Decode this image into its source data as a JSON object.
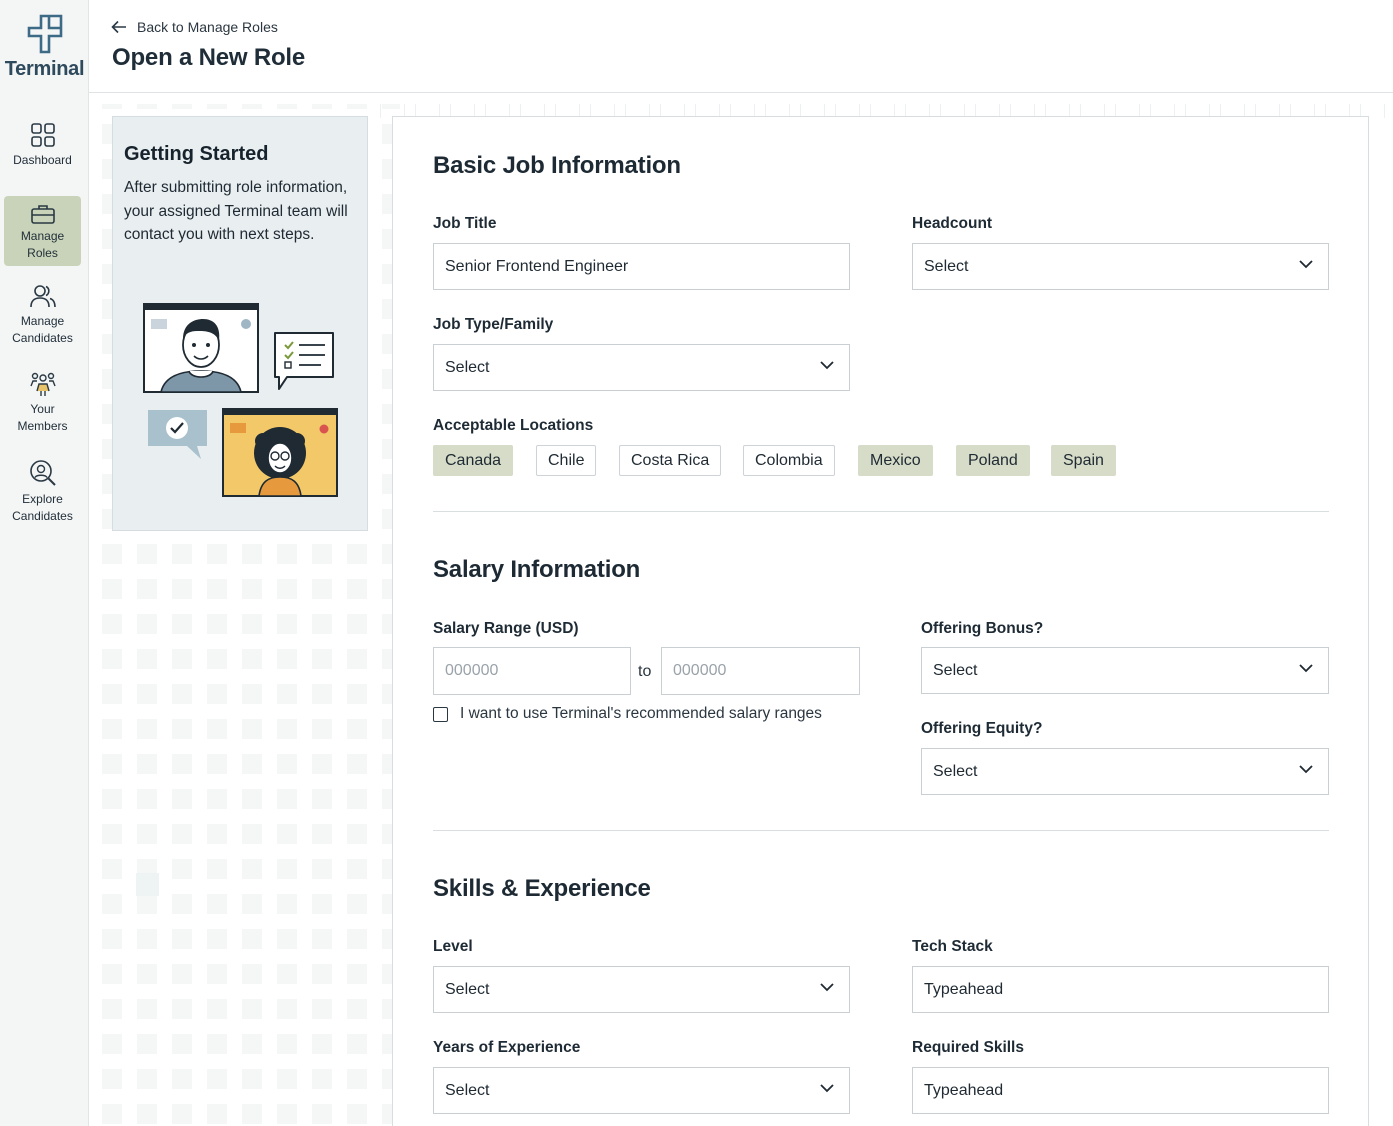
{
  "app": {
    "name": "Terminal"
  },
  "sidebar": {
    "items": [
      {
        "label_line1": "Dashboard",
        "label_line2": "",
        "icon": "dashboard-grid-icon",
        "active": false
      },
      {
        "label_line1": "Manage",
        "label_line2": "Roles",
        "icon": "briefcase-icon",
        "active": true
      },
      {
        "label_line1": "Manage",
        "label_line2": "Candidates",
        "icon": "people-icon",
        "active": false
      },
      {
        "label_line1": "Your",
        "label_line2": "Members",
        "icon": "team-icon",
        "active": false
      },
      {
        "label_line1": "Explore",
        "label_line2": "Candidates",
        "icon": "search-person-icon",
        "active": false
      }
    ]
  },
  "header": {
    "back_label": "Back to Manage Roles",
    "title": "Open a New Role"
  },
  "getting_started": {
    "title": "Getting Started",
    "body": "After submitting role information, your assigned Terminal team will contact you with next steps."
  },
  "basic": {
    "title": "Basic Job Information",
    "job_title_label": "Job Title",
    "job_title_value": "Senior Frontend Engineer",
    "headcount_label": "Headcount",
    "headcount_value": "Select",
    "job_type_label": "Job Type/Family",
    "job_type_value": "Select",
    "locations_label": "Acceptable Locations",
    "locations": [
      {
        "name": "Canada",
        "selected": true
      },
      {
        "name": "Chile",
        "selected": false
      },
      {
        "name": "Costa Rica",
        "selected": false
      },
      {
        "name": "Colombia",
        "selected": false
      },
      {
        "name": "Mexico",
        "selected": true
      },
      {
        "name": "Poland",
        "selected": true
      },
      {
        "name": "Spain",
        "selected": true
      }
    ]
  },
  "salary": {
    "title": "Salary Information",
    "range_label": "Salary Range (USD)",
    "min_placeholder": "000000",
    "to_label": "to",
    "max_placeholder": "000000",
    "recommended_label": "I want to use Terminal's recommended salary ranges",
    "recommended_checked": false,
    "bonus_label": "Offering Bonus?",
    "bonus_value": "Select",
    "equity_label": "Offering Equity?",
    "equity_value": "Select"
  },
  "skills": {
    "title": "Skills & Experience",
    "level_label": "Level",
    "level_value": "Select",
    "tech_stack_label": "Tech Stack",
    "tech_stack_value": "Typeahead",
    "years_label": "Years of Experience",
    "years_value": "Select",
    "required_skills_label": "Required Skills",
    "required_skills_value": "Typeahead"
  },
  "colors": {
    "active_nav": "#c9d3b9",
    "chip_selected": "#d6dcc8",
    "brand": "#2e4a5c"
  }
}
